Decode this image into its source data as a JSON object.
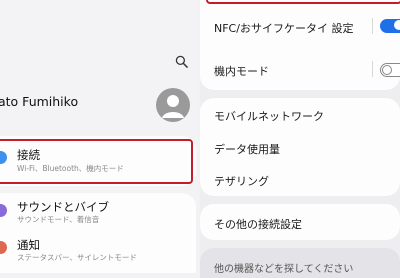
{
  "profile": {
    "name": "ato Fumihiko"
  },
  "left_menu": [
    {
      "title": "接続",
      "subtitle": "Wi-Fi、Bluetooth、機内モード",
      "icon": "wifi-icon",
      "color": "#3d8ff0"
    },
    {
      "title": "サウンドとバイブ",
      "subtitle": "サウンドモード、着信音",
      "icon": "sound-icon",
      "color": "#8a6ad8"
    },
    {
      "title": "通知",
      "subtitle": "ステータスバー、サイレントモード",
      "icon": "notification-icon",
      "color": "#e0674f"
    }
  ],
  "right_panel": {
    "nfc": "NFC/おサイフケータイ 設定",
    "airplane": "機内モード",
    "mobile_network": "モバイルネットワーク",
    "data_usage": "データ使用量",
    "tethering": "テザリング",
    "more": "その他の接続設定",
    "bottom_partial": "他の機器などを探してください"
  },
  "colors": {
    "accent": "#1e6fe8",
    "highlight": "#c21d2a"
  },
  "toggles": {
    "nfc_on": true,
    "airplane_on": false
  }
}
